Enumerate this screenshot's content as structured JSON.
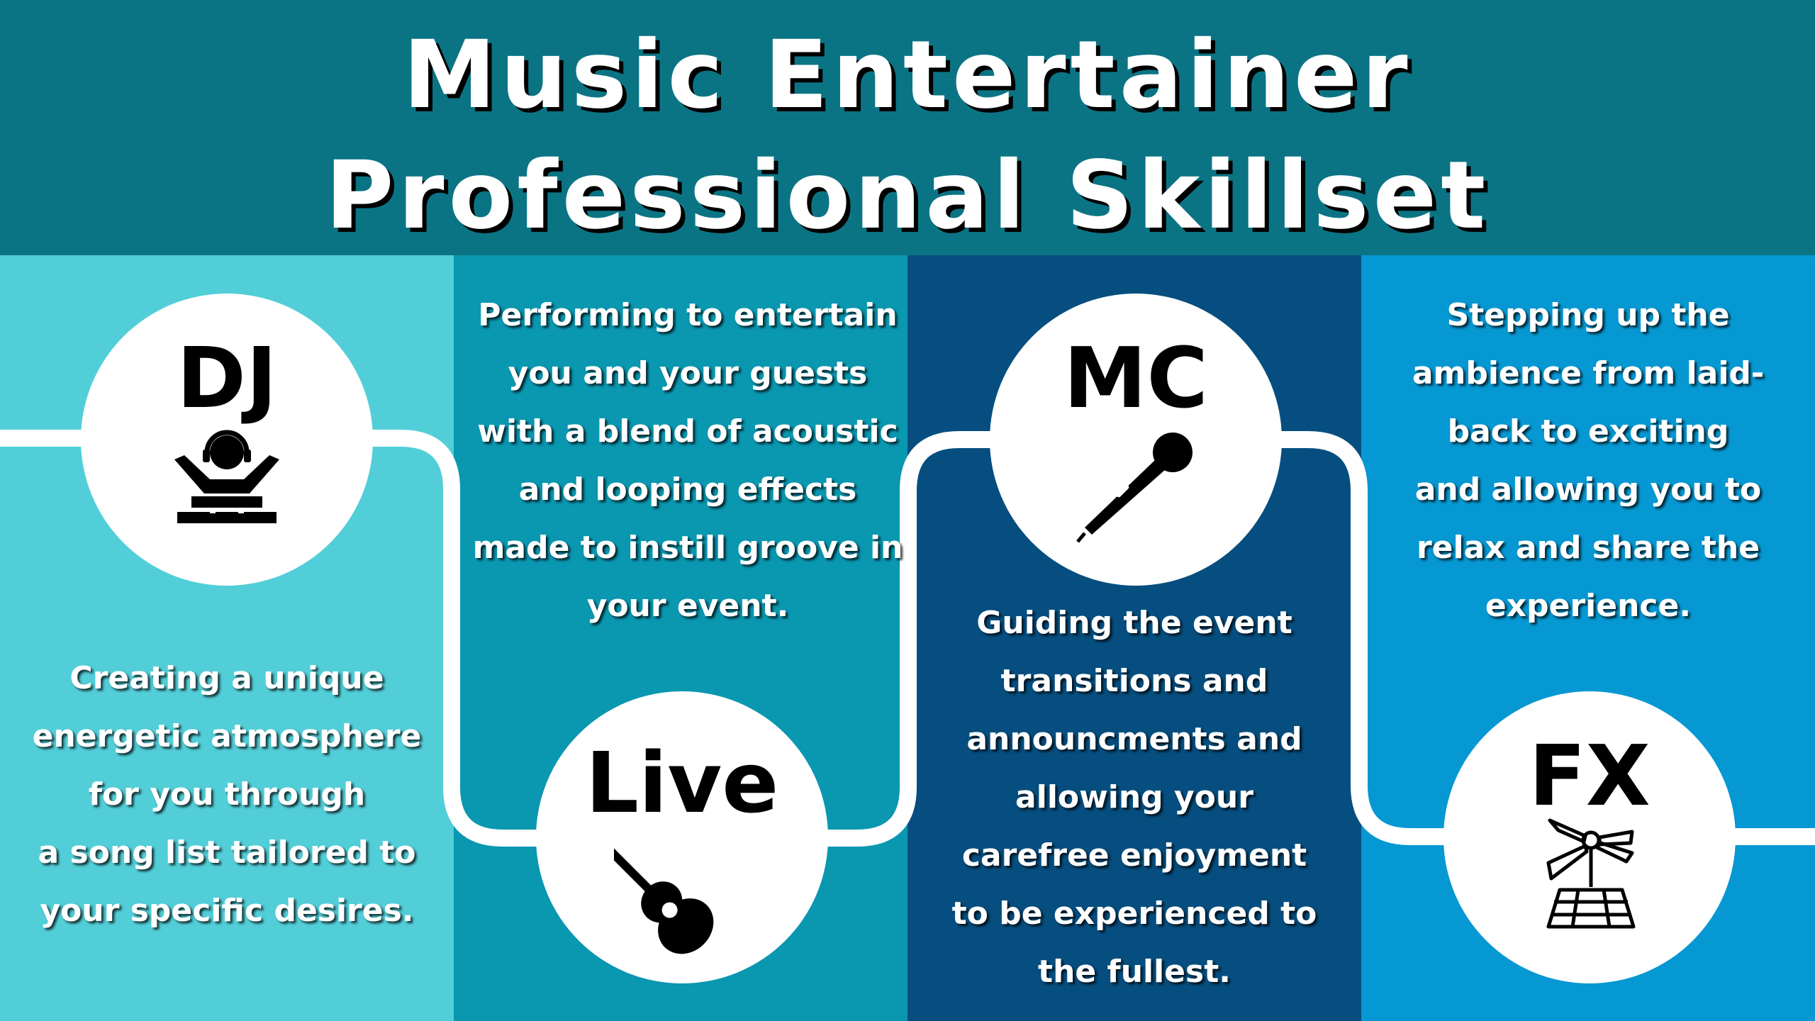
{
  "title": {
    "line1": "Music Entertainer",
    "line2": "Professional Skillset"
  },
  "colors": {
    "header": "#0b7484",
    "column_dj": "#52ced8",
    "column_live": "#0a97b0",
    "column_mc": "#064e7f",
    "column_fx": "#0698d2",
    "connector": "#ffffff"
  },
  "skills": [
    {
      "label": "DJ",
      "icon": "dj-icon",
      "description": [
        "Creating a unique",
        "energetic atmosphere",
        "for you through",
        "a song list tailored to",
        "your specific desires."
      ]
    },
    {
      "label": "Live",
      "icon": "acoustic-guitar-icon",
      "description": [
        "Performing to entertain",
        "you and your guests",
        "with a blend of acoustic",
        "and looping effects",
        "made to instill groove in",
        "your event."
      ]
    },
    {
      "label": "MC",
      "icon": "microphone-icon",
      "description": [
        "Guiding the event",
        "transitions and",
        "announcments and",
        "allowing your",
        "carefree enjoyment",
        "to be experienced to",
        "the fullest."
      ]
    },
    {
      "label": "FX",
      "icon": "stage-lights-icon",
      "description": [
        "Stepping up the",
        "ambience from laid-",
        "back to exciting",
        "and allowing you to",
        "relax and share the",
        "experience."
      ]
    }
  ]
}
